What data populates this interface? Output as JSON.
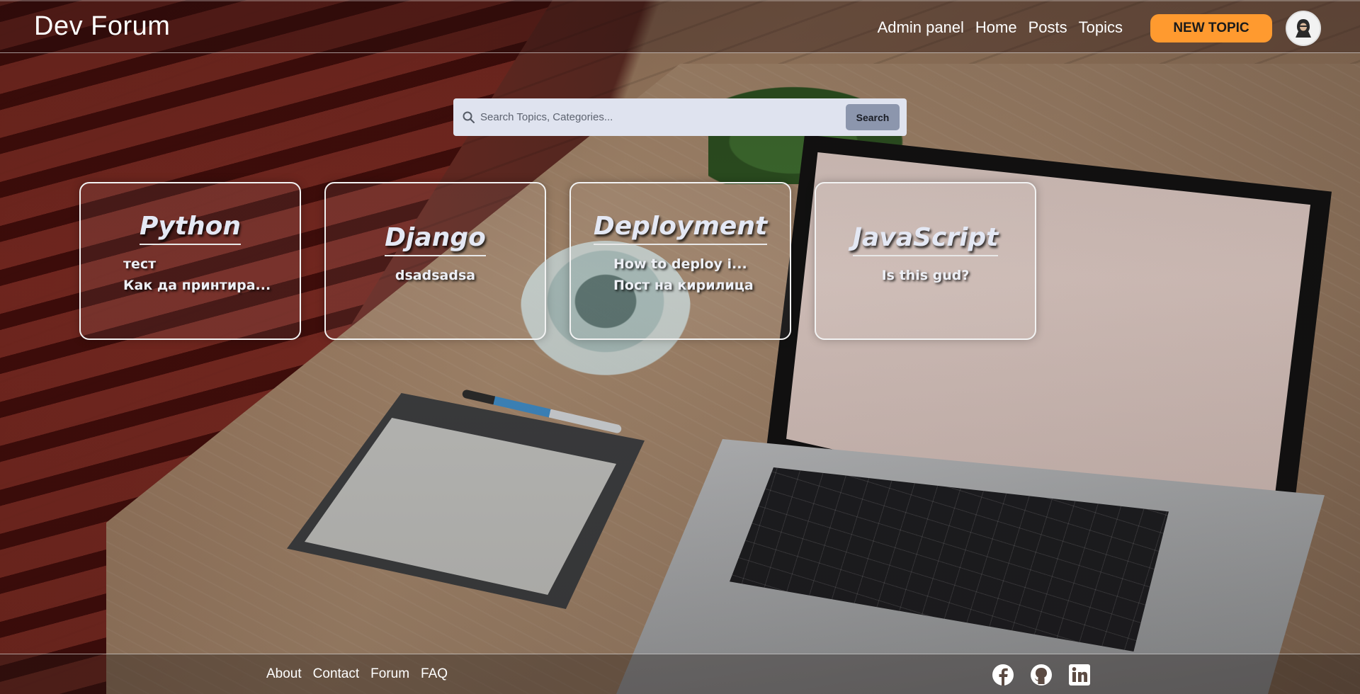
{
  "header": {
    "brand": "Dev Forum",
    "nav": [
      "Admin panel",
      "Home",
      "Posts",
      "Topics"
    ],
    "new_topic_label": "NEW TOPIC",
    "avatar_icon": "user-avatar-icon"
  },
  "search": {
    "placeholder": "Search Topics, Categories...",
    "button_label": "Search",
    "icon": "search-icon"
  },
  "topics": [
    {
      "title": "Python",
      "posts": [
        "тест",
        "Как да принтира..."
      ]
    },
    {
      "title": "Django",
      "posts": [
        "dsadsadsa"
      ]
    },
    {
      "title": "Deployment",
      "posts": [
        "How to deploy i...",
        "Пост на кирилица"
      ]
    },
    {
      "title": "JavaScript",
      "posts": [
        "Is this gud?"
      ]
    }
  ],
  "footer": {
    "links": [
      "About",
      "Contact",
      "Forum",
      "FAQ"
    ],
    "social_icons": [
      "facebook-icon",
      "github-icon",
      "linkedin-icon"
    ]
  },
  "colors": {
    "accent": "#ff9a2f",
    "search_bg": "#dfe3ef",
    "search_button": "#8c96ad"
  }
}
